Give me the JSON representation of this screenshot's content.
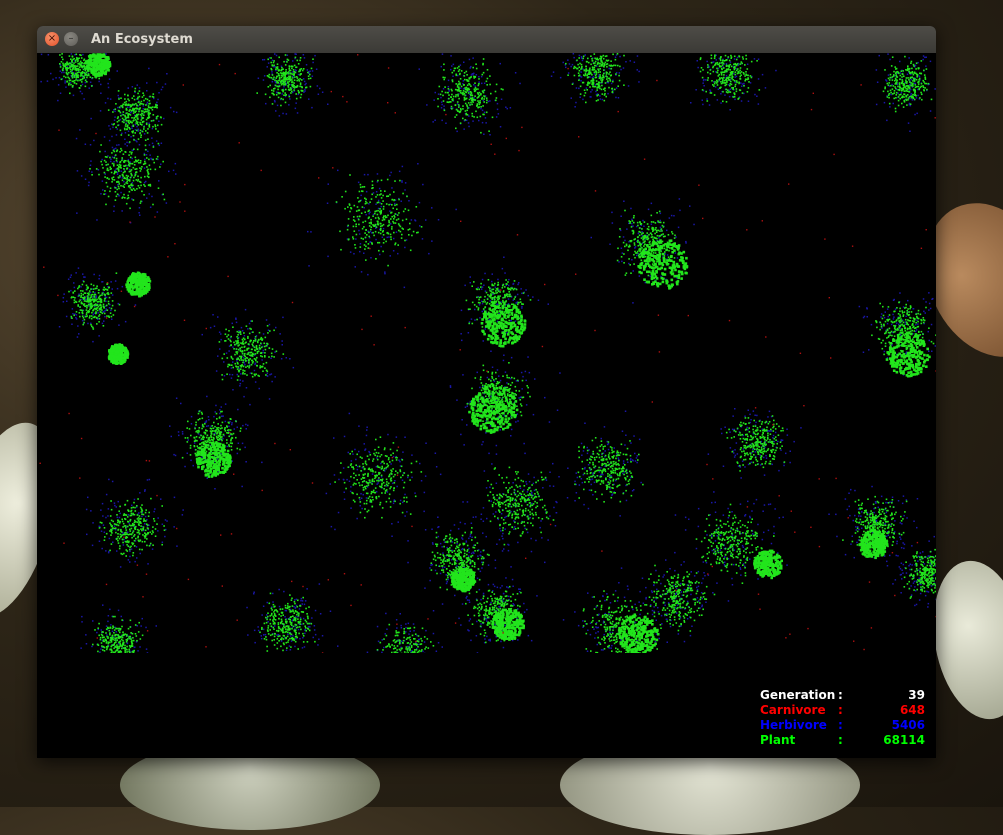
{
  "window": {
    "title": "An Ecosystem",
    "close_label": "×",
    "minimize_label": "–"
  },
  "stats": [
    {
      "label": "Generation",
      "separator": ":",
      "value": "39",
      "color": "#ffffff"
    },
    {
      "label": "Carnivore",
      "separator": ":",
      "value": "648",
      "color": "#ff0000"
    },
    {
      "label": "Herbivore",
      "separator": ":",
      "value": "5406",
      "color": "#0000ff"
    },
    {
      "label": "Plant",
      "separator": ":",
      "value": "68114",
      "color": "#00ff00"
    }
  ],
  "colors": {
    "plant": "#22e51c",
    "herbivore": "#1a17a8",
    "carnivore": "#b01010",
    "background": "#000000"
  }
}
